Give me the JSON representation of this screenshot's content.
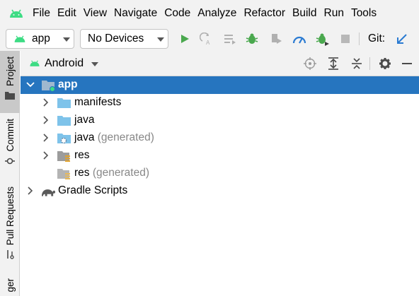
{
  "menu": {
    "items": [
      {
        "label": "File"
      },
      {
        "label": "Edit"
      },
      {
        "label": "View"
      },
      {
        "label": "Navigate"
      },
      {
        "label": "Code"
      },
      {
        "label": "Analyze"
      },
      {
        "label": "Refactor"
      },
      {
        "label": "Build"
      },
      {
        "label": "Run"
      },
      {
        "label": "Tools"
      }
    ]
  },
  "toolbar": {
    "run_config": "app",
    "device": "No Devices",
    "git_label": "Git:"
  },
  "left_strip": {
    "tabs": [
      {
        "label": "Project"
      },
      {
        "label": "Commit"
      },
      {
        "label": "Pull Requests"
      },
      {
        "label": "ger"
      }
    ]
  },
  "project_panel": {
    "view": "Android"
  },
  "tree": {
    "app": "app",
    "manifests": "manifests",
    "java": "java",
    "java_generated": {
      "name": "java",
      "suffix": "(generated)"
    },
    "res": "res",
    "res_generated": {
      "name": "res",
      "suffix": "(generated)"
    },
    "gradle": "Gradle Scripts"
  },
  "colors": {
    "selection": "#2675bf",
    "folder": "#7ec3ea",
    "android_green": "#3ddc84",
    "run_green": "#4aa84e",
    "accent_blue": "#2b7bd2"
  }
}
